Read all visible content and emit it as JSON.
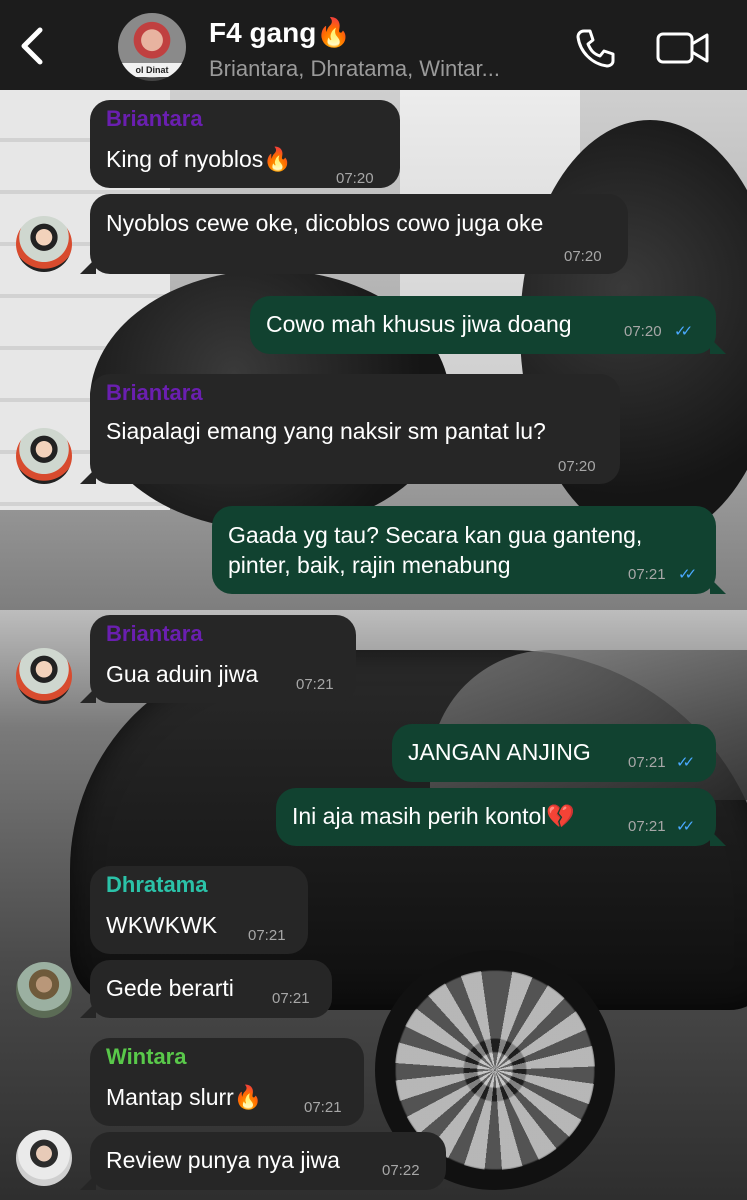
{
  "header": {
    "title": "F4 gang🔥",
    "subtitle": "Briantara, Dhratama, Wintar...",
    "avatar_caption": "ol Dinat"
  },
  "colors": {
    "Briantara": "#6a1fb0",
    "Dhratama": "#2bc2a8",
    "Wintara": "#59c84a",
    "incoming_bubble": "#262626",
    "outgoing_bubble": "#114230",
    "read_ticks": "#4aa9ff"
  },
  "messages": [
    {
      "sender": "Briantara",
      "text": "King of nyoblos🔥",
      "time": "07:20"
    },
    {
      "sender": "",
      "text": "Nyoblos cewe oke, dicoblos cowo juga oke",
      "time": "07:20"
    },
    {
      "sender": "",
      "text": "Cowo mah khusus jiwa doang",
      "time": "07:20"
    },
    {
      "sender": "Briantara",
      "text": "Siapalagi emang yang naksir sm pantat lu?",
      "time": "07:20"
    },
    {
      "sender": "",
      "text": "Gaada yg tau? Secara kan gua ganteng,",
      "text2": "pinter, baik, rajin menabung",
      "time": "07:21"
    },
    {
      "sender": "Briantara",
      "text": "Gua aduin jiwa",
      "time": "07:21"
    },
    {
      "sender": "",
      "text": "JANGAN ANJING",
      "time": "07:21"
    },
    {
      "sender": "",
      "text": "Ini aja masih perih kontol💔",
      "time": "07:21"
    },
    {
      "sender": "Dhratama",
      "text": "WKWKWK",
      "time": "07:21"
    },
    {
      "sender": "",
      "text": "Gede berarti",
      "time": "07:21"
    },
    {
      "sender": "Wintara",
      "text": "Mantap slurr🔥",
      "time": "07:21"
    },
    {
      "sender": "",
      "text": "Review punya nya jiwa",
      "time": "07:22"
    }
  ],
  "icons": {
    "back": "chevron-left-icon",
    "call": "phone-icon",
    "video": "video-camera-icon",
    "read": "double-check-icon"
  }
}
